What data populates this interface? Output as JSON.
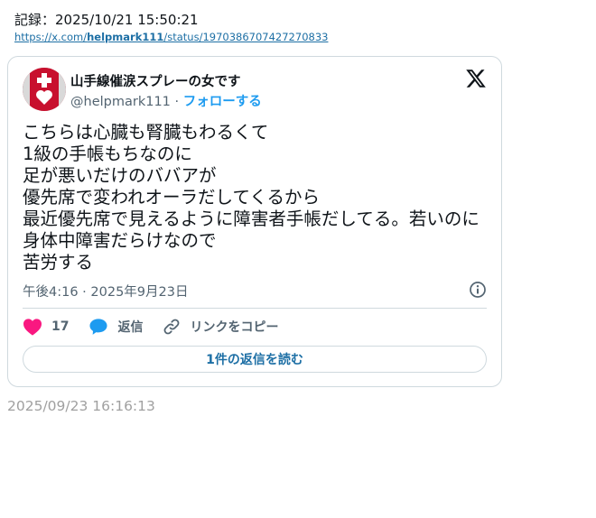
{
  "header": {
    "record_label": "記録：2025/10/21 15:50:21",
    "link_prefix": "https://x.com/",
    "link_user": "helpmark111",
    "link_suffix": "/status/1970386707427270833"
  },
  "tweet": {
    "display_name": "山手線催涙スプレーの女です",
    "handle": "@helpmark111",
    "separator": " · ",
    "follow_label": "フォローする",
    "text": "こちらは心臓も腎臓もわるくて\n1級の手帳もちなのに\n足が悪いだけのババアが\n優先席で変われオーラだしてくるから\n最近優先席で見えるように障害者手帳だしてる。若いのに身体中障害だらけなので\n苦労する",
    "timestamp": "午後4:16 · 2025年9月23日",
    "like_count": "17",
    "reply_label": "返信",
    "copy_link_label": "リンクをコピー",
    "read_replies_label": "1件の返信を読む"
  },
  "footer": {
    "post_datetime": "2025/09/23 16:16:13"
  },
  "colors": {
    "like": "#f91880",
    "reply": "#1d9bf0",
    "link": "#1d6fa5",
    "muted": "#536471"
  },
  "icons": [
    "x-logo-icon",
    "info-icon",
    "heart-icon",
    "reply-bubble-icon",
    "link-icon",
    "avatar-helpmark-icon"
  ]
}
